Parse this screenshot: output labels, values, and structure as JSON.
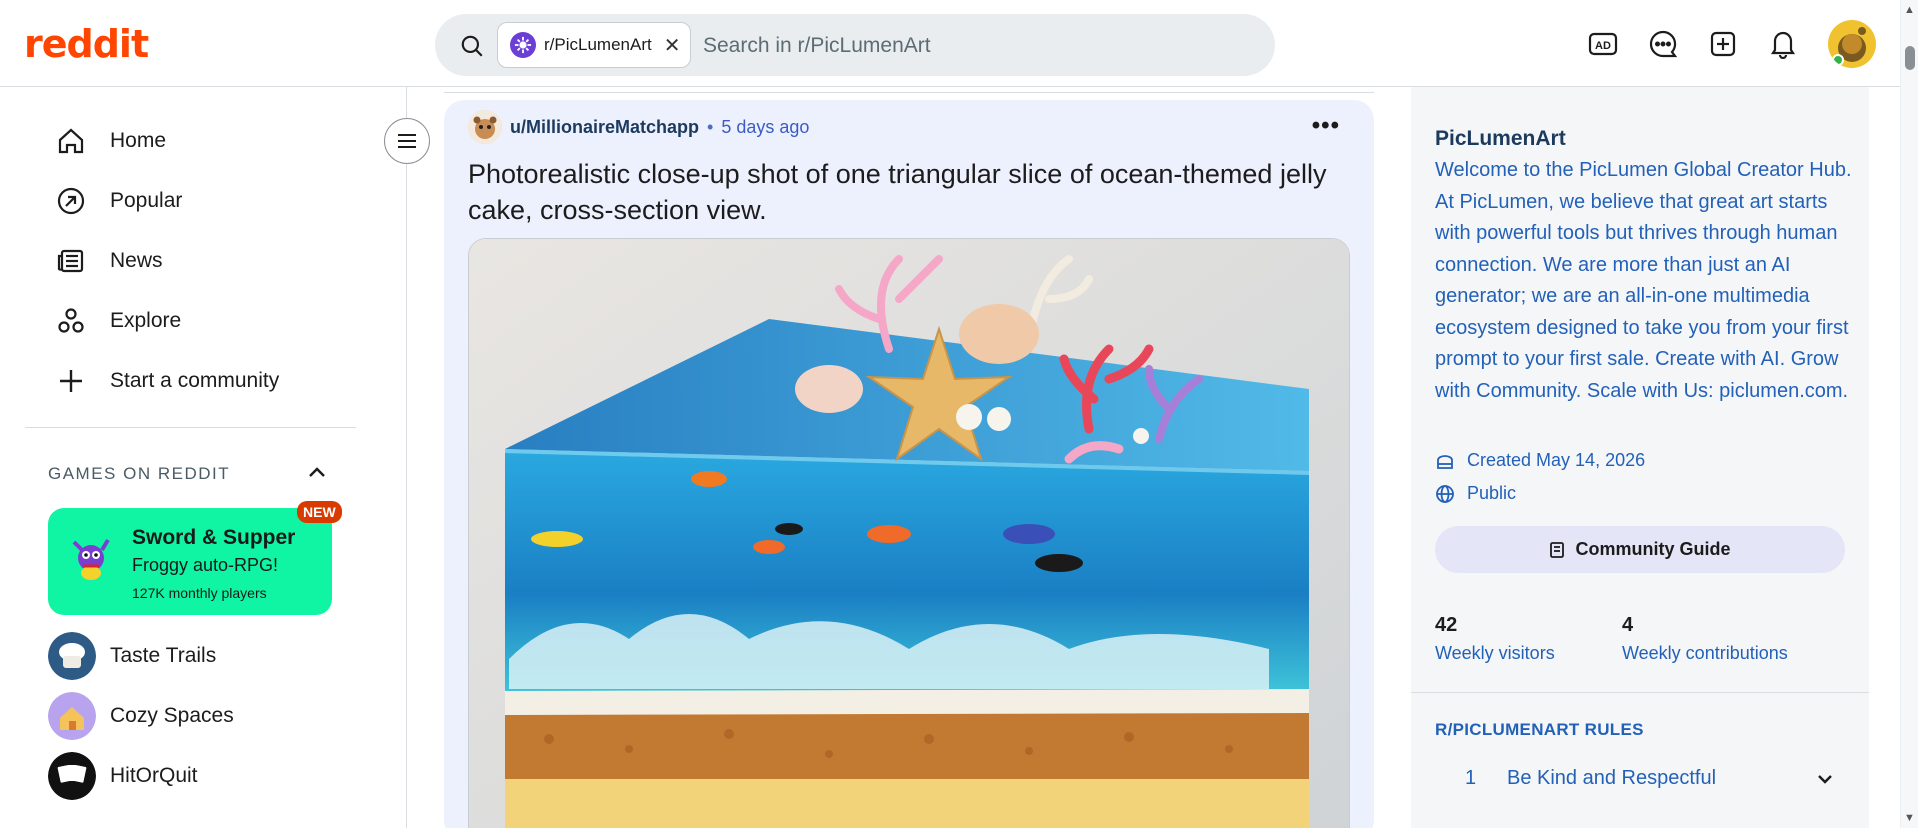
{
  "header": {
    "logo": "reddit",
    "search_chip": "r/PicLumenArt",
    "search_placeholder": "Search in r/PicLumenArt",
    "icons": [
      "ad-icon",
      "chat-icon",
      "create-post-icon",
      "notification-bell-icon",
      "user-avatar"
    ]
  },
  "nav": {
    "items": [
      {
        "label": "Home",
        "icon": "home-icon"
      },
      {
        "label": "Popular",
        "icon": "popular-icon"
      },
      {
        "label": "News",
        "icon": "news-icon"
      },
      {
        "label": "Explore",
        "icon": "explore-icon"
      },
      {
        "label": "Start a community",
        "icon": "plus-icon"
      }
    ],
    "games_section_title": "GAMES ON REDDIT",
    "featured_game": {
      "title": "Sword & Supper",
      "subtitle": "Froggy auto-RPG!",
      "players": "127K monthly players",
      "badge": "NEW"
    },
    "games": [
      {
        "label": "Taste Trails"
      },
      {
        "label": "Cozy Spaces"
      },
      {
        "label": "HitOrQuit"
      }
    ]
  },
  "post": {
    "author": "u/MillionaireMatchapp",
    "separator": "•",
    "age": "5 days ago",
    "more": "•••",
    "title": "Photorealistic close-up shot of one triangular slice of ocean-themed jelly cake, cross-section view."
  },
  "sidebar": {
    "community_name": "PicLumenArt",
    "description": "Welcome to the PicLumen Global Creator Hub. At PicLumen, we believe that great art starts with powerful tools but thrives through human connection. We are more than just an AI generator; we are an all-in-one multimedia ecosystem designed to take you from your first prompt to your first sale. Create with AI. Grow with Community. Scale with Us: piclumen.com.",
    "created": "Created May 14, 2026",
    "visibility": "Public",
    "guide_button": "Community Guide",
    "stats": [
      {
        "value": "42",
        "label": "Weekly visitors"
      },
      {
        "value": "4",
        "label": "Weekly contributions"
      }
    ],
    "rules_title": "R/PICLUMENART RULES",
    "rules": [
      {
        "number": "1",
        "label": "Be Kind and Respectful"
      }
    ]
  },
  "colors": {
    "brand": "#ff4500",
    "link_blue": "#2361b8",
    "game_card": "#10f5a3",
    "post_bg": "#edf1fe"
  }
}
